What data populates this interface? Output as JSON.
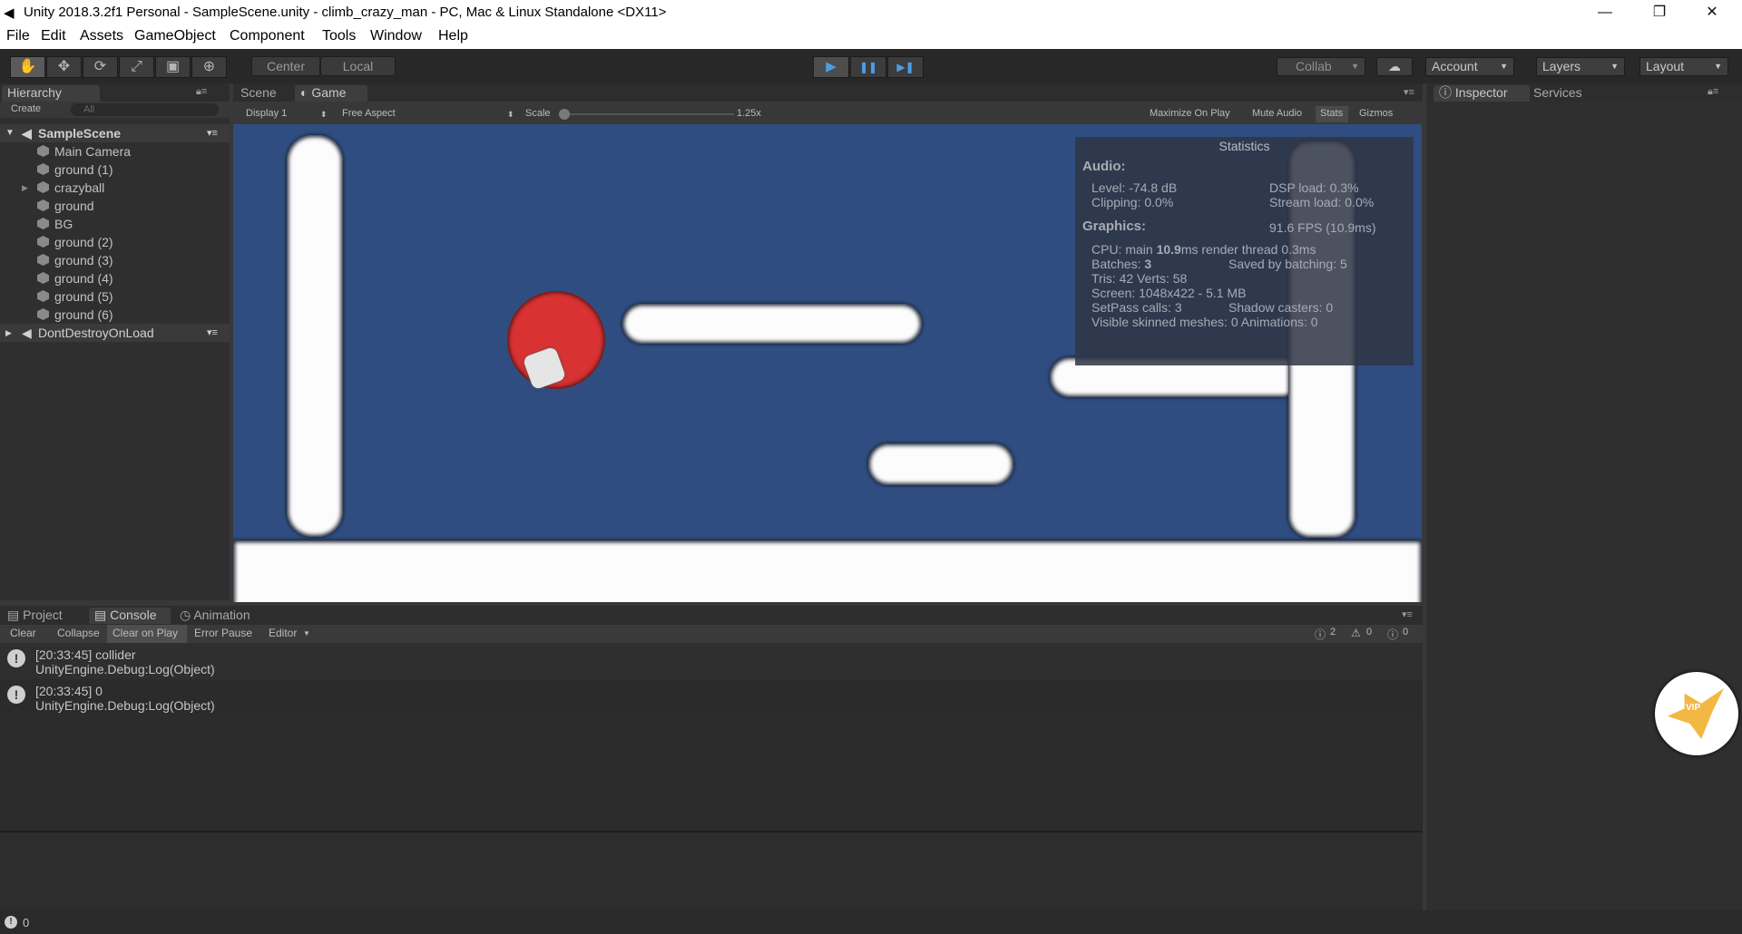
{
  "window": {
    "title": "Unity 2018.3.2f1 Personal - SampleScene.unity - climb_crazy_man - PC, Mac & Linux Standalone <DX11>",
    "minimize": "—",
    "restore": "❐",
    "close": "✕"
  },
  "menu": [
    "File",
    "Edit",
    "Assets",
    "GameObject",
    "Component",
    "Tools",
    "Window",
    "Help"
  ],
  "toolbar": {
    "tools": [
      "✋",
      "✥",
      "⟳",
      "⤢",
      "▣",
      "⊕"
    ],
    "pivot": "Center",
    "space": "Local",
    "play": "▶",
    "pause": "❚❚",
    "step": "▶❚",
    "collab": "Collab",
    "cloud": "☁",
    "account": "Account",
    "layers": "Layers",
    "layout": "Layout"
  },
  "hierarchy": {
    "tab": "Hierarchy",
    "create": "Create",
    "search_placeholder": "All",
    "scene": "SampleScene",
    "items": [
      "Main Camera",
      "ground (1)",
      "crazyball",
      "ground",
      "BG",
      "ground (2)",
      "ground (3)",
      "ground (4)",
      "ground (5)",
      "ground (6)"
    ],
    "dont_destroy": "DontDestroyOnLoad"
  },
  "game_tabs": {
    "scene": "Scene",
    "game": "Game",
    "display": "Display 1",
    "aspect": "Free Aspect",
    "scale_label": "Scale",
    "scale_value": "1.25x",
    "maximize": "Maximize On Play",
    "mute": "Mute Audio",
    "stats": "Stats",
    "gizmos": "Gizmos"
  },
  "statistics": {
    "title": "Statistics",
    "audio_header": "Audio:",
    "level": "Level: -74.8 dB",
    "dsp": "DSP load: 0.3%",
    "clipping": "Clipping: 0.0%",
    "stream": "Stream load: 0.0%",
    "graphics_header": "Graphics:",
    "fps": "91.6 FPS (10.9ms)",
    "cpu_prefix": "CPU: main ",
    "cpu_main": "10.9",
    "cpu_suffix": "ms  render thread 0.3ms",
    "batches_prefix": "Batches: ",
    "batches": "3",
    "saved": "Saved by batching: 5",
    "tris": "Tris: 42   Verts: 58",
    "screen": "Screen: 1048x422 - 5.1 MB",
    "setpass": "SetPass calls: 3",
    "shadow": "Shadow casters: 0",
    "skinned": "Visible skinned meshes: 0  Animations: 0"
  },
  "bottom_tabs": {
    "project": "Project",
    "console": "Console",
    "animation": "Animation"
  },
  "console": {
    "clear": "Clear",
    "collapse": "Collapse",
    "clear_on_play": "Clear on Play",
    "error_pause": "Error Pause",
    "editor": "Editor",
    "log_count": "2",
    "warn_count": "0",
    "error_count": "0",
    "entries": [
      {
        "line1": "[20:33:45] collider",
        "line2": "UnityEngine.Debug:Log(Object)"
      },
      {
        "line1": "[20:33:45] 0",
        "line2": "UnityEngine.Debug:Log(Object)"
      }
    ]
  },
  "inspector": {
    "tab": "Inspector",
    "services": "Services"
  },
  "status": {
    "message": "0"
  },
  "badge": {
    "text": "VIP"
  }
}
